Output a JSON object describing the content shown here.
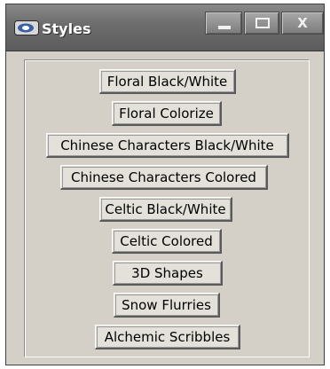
{
  "window": {
    "title": "Styles"
  },
  "buttons": [
    "Floral Black/White",
    "Floral Colorize",
    "Chinese Characters Black/White",
    "Chinese Characters Colored",
    "Celtic Black/White",
    "Celtic Colored",
    "3D Shapes",
    "Snow Flurries",
    "Alchemic Scribbles"
  ],
  "colors": {
    "window_bg": "#d4d0c8",
    "titlebar": "#6e6e6e",
    "title_text": "#ffffff"
  }
}
